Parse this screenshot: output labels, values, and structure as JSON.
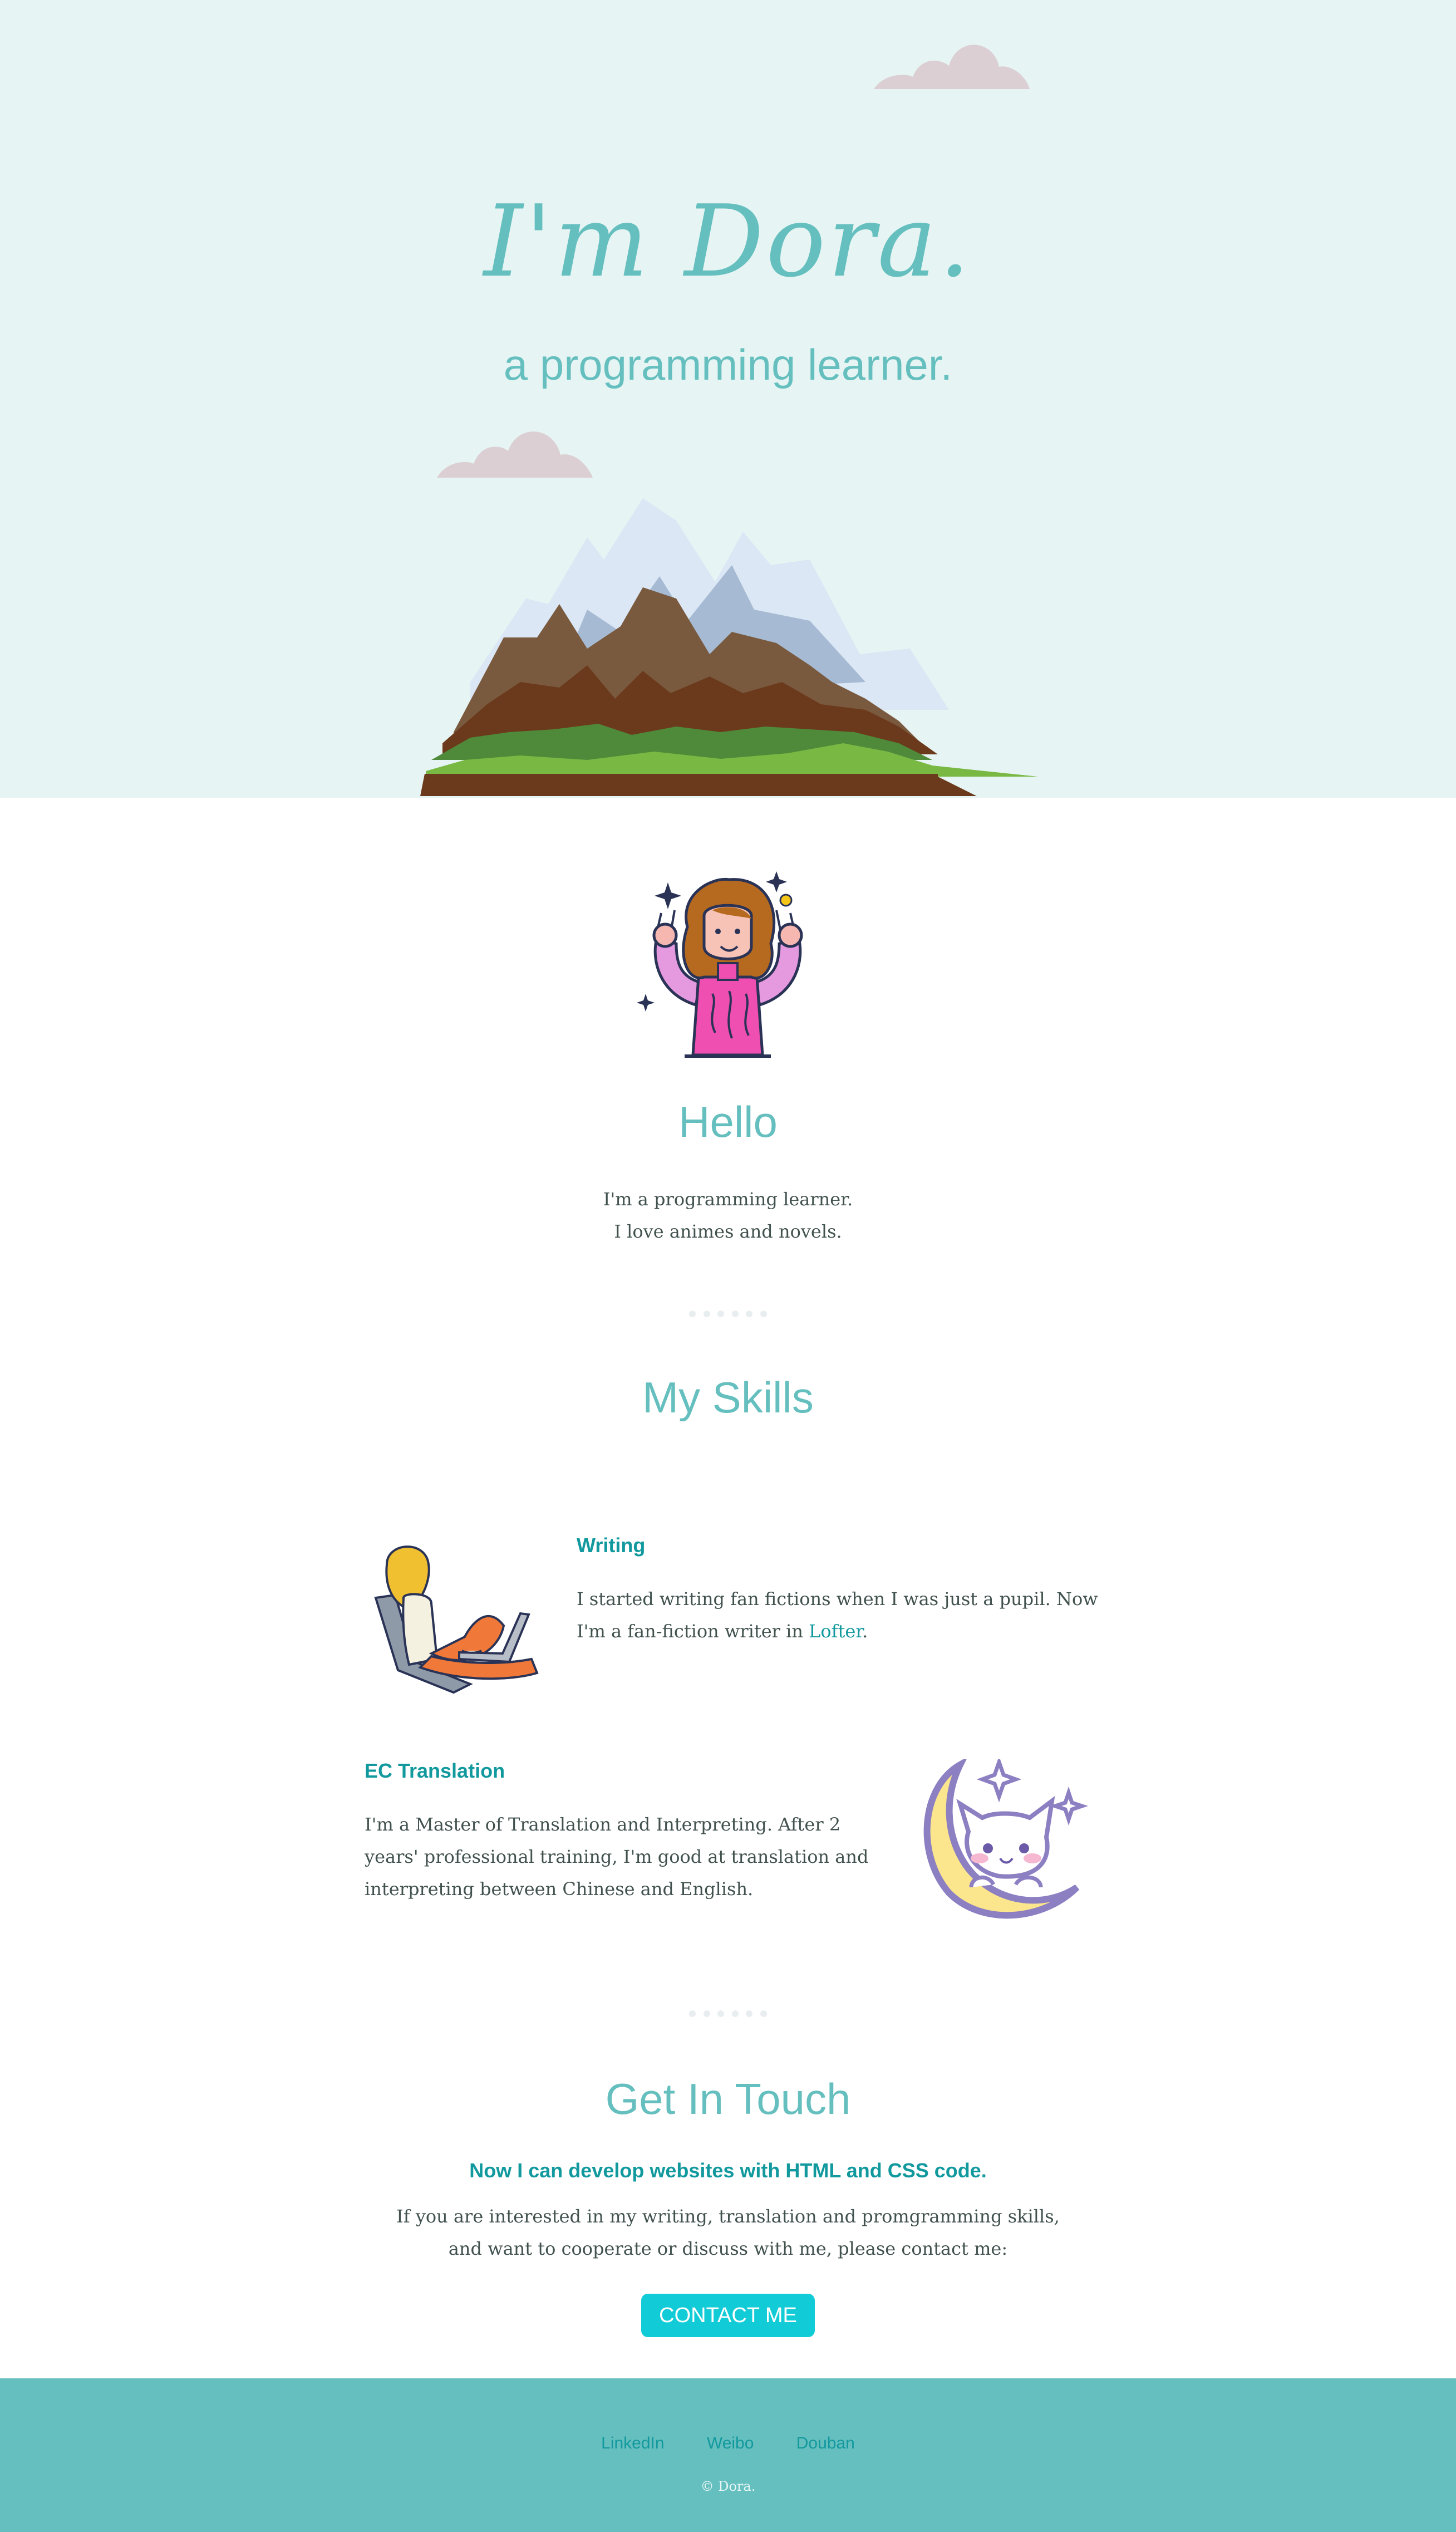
{
  "hero": {
    "title": "I'm Dora.",
    "subtitle": "a programming learner."
  },
  "intro": {
    "heading": "Hello",
    "lines": [
      "I'm a programming learner.",
      "I love animes and novels."
    ]
  },
  "skills": {
    "heading": "My Skills",
    "items": [
      {
        "title": "Writing",
        "text_before": "I started writing fan fictions when I was just a pupil. Now I'm a fan-fiction writer in ",
        "link": "Lofter",
        "text_after": "."
      },
      {
        "title": "EC Translation",
        "text": "I'm a Master of Translation and Interpreting. After 2 years' professional training, I'm good at translation and interpreting between Chinese and English."
      }
    ]
  },
  "contact": {
    "heading": "Get In Touch",
    "subheading": "Now I can develop websites with HTML and CSS code.",
    "lines": [
      "If you are interested in my writing, translation and promgramming skills,",
      "and want to cooperate or discuss with me, please contact me:"
    ],
    "button": "CONTACT ME"
  },
  "footer": {
    "links": [
      "LinkedIn",
      "Weibo",
      "Douban"
    ],
    "copyright": "© Dora."
  },
  "colors": {
    "hero_bg": "#e6f5f3",
    "accent": "#66bfbf",
    "accent_dark": "#11999e",
    "button": "#11cbd7",
    "text": "#40514e"
  },
  "icons": [
    "cloud-icon",
    "mountain-illustration",
    "girl-avatar-illustration",
    "writer-laptop-illustration",
    "cat-moon-illustration"
  ]
}
